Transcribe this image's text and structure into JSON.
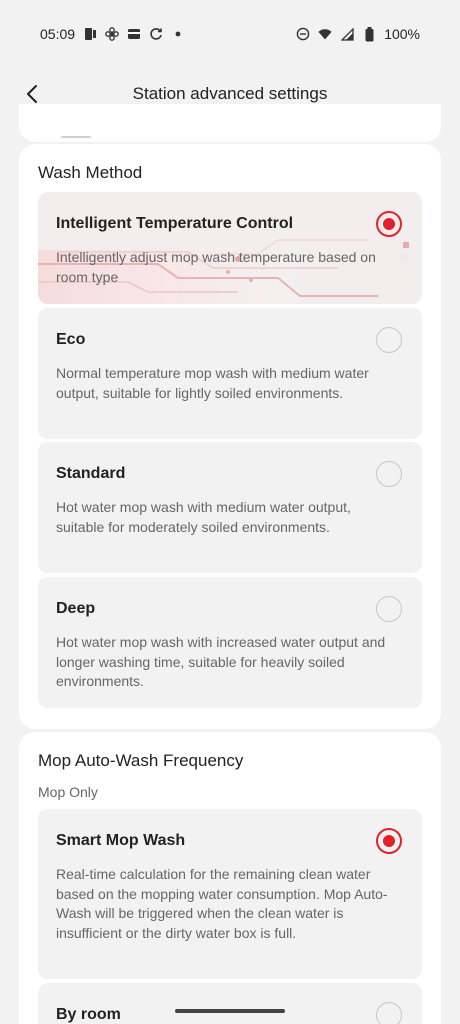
{
  "status_bar": {
    "time": "05:09",
    "battery": "100%",
    "icons_left": [
      "sim-icon",
      "fan-icon",
      "card-icon",
      "sync-icon",
      "dot-icon"
    ],
    "icons_right": [
      "dnd-icon",
      "wifi-icon",
      "signal-icon",
      "battery-icon"
    ]
  },
  "header": {
    "title": "Station advanced settings",
    "back_icon": "chevron-left-icon"
  },
  "wash_method": {
    "title": "Wash Method",
    "options": [
      {
        "title": "Intelligent Temperature Control",
        "description": "Intelligently adjust mop wash temperature based on room type",
        "selected": true
      },
      {
        "title": "Eco",
        "description": "Normal temperature mop wash with medium water output, suitable for lightly soiled environments.",
        "selected": false
      },
      {
        "title": "Standard",
        "description": "Hot water mop wash with medium water output, suitable for moderately soiled environments.",
        "selected": false
      },
      {
        "title": "Deep",
        "description": "Hot water mop wash with increased water output and longer washing time, suitable for heavily soiled environments.",
        "selected": false
      }
    ]
  },
  "mop_frequency": {
    "title": "Mop Auto-Wash Frequency",
    "subtitle": "Mop Only",
    "options": [
      {
        "title": "Smart Mop Wash",
        "description": "Real-time calculation for the remaining clean water based on the mopping water consumption. Mop Auto-Wash will be triggered when the clean water is insufficient or the dirty water box is full.",
        "selected": true
      },
      {
        "title": "By room",
        "selected": false
      }
    ]
  },
  "colors": {
    "accent": "#e0232b",
    "background": "#f2f2f2",
    "card": "#ffffff",
    "option_bg": "#f2f2f2"
  }
}
